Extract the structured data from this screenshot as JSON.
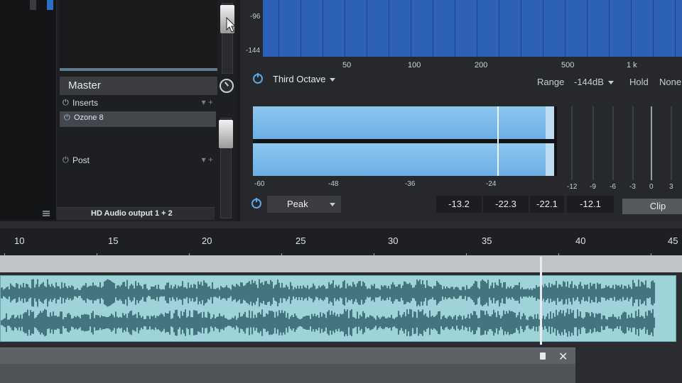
{
  "channel": {
    "name": "Master",
    "inserts_label": "Inserts",
    "plugin_label": "Ozone 8",
    "post_label": "Post",
    "output_label": "HD Audio output 1 + 2"
  },
  "analyzer": {
    "db_ticks": [
      "-96",
      "-144"
    ],
    "freq_ticks": [
      "50",
      "100",
      "200",
      "500",
      "1 k"
    ],
    "mode_label": "Third Octave",
    "range_label": "Range",
    "range_value": "-144dB",
    "hold_label": "Hold",
    "hold_value": "None"
  },
  "level_meter": {
    "scale": [
      "-60",
      "-48",
      "-36",
      "-24"
    ],
    "right_scale": [
      "-12",
      "-9",
      "-6",
      "-3",
      "0",
      "3"
    ],
    "peak_mode": "Peak",
    "readouts": [
      "-13.2",
      "-22.3",
      "-22.1",
      "-12.1"
    ],
    "clip_label": "Clip"
  },
  "timeline": {
    "ruler_labels": [
      "10",
      "15",
      "20",
      "25",
      "30",
      "35",
      "40",
      "45"
    ]
  },
  "colors": {
    "spectrum_blue": "#2d61b8",
    "meter_blue": "#8ec6ef",
    "waveform_bg": "#9ed4d8",
    "waveform_fg": "#2e5d69"
  }
}
